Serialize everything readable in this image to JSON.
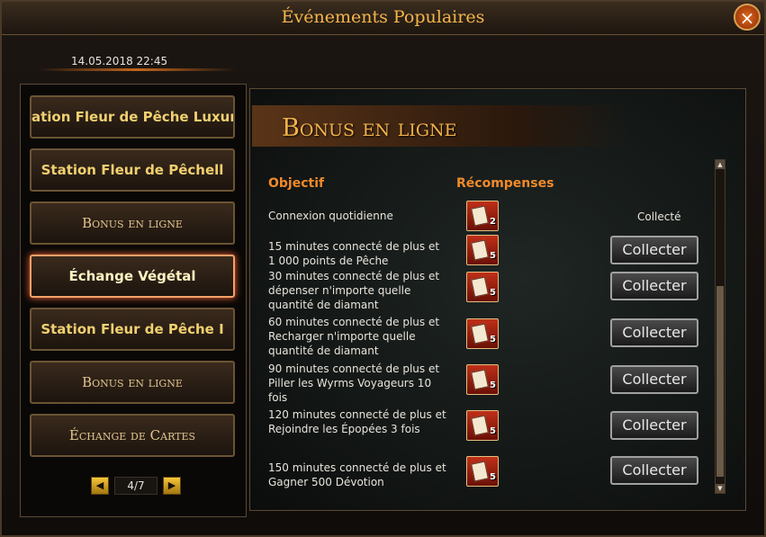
{
  "window": {
    "title": "Événements Populaires",
    "close_icon": "close-icon"
  },
  "datetime": "14.05.2018 22:45",
  "events": [
    {
      "label": "ation Fleur de Pêche Luxuriante",
      "style": "bold"
    },
    {
      "label": "Station Fleur de Pêchell",
      "style": "bold"
    },
    {
      "label": "Bonus en ligne",
      "style": "serif"
    },
    {
      "label": "Échange Végétal",
      "style": "bold",
      "active": true
    },
    {
      "label": "Station Fleur de Pêche I",
      "style": "bold"
    },
    {
      "label": "Bonus en ligne",
      "style": "serif"
    },
    {
      "label": "Échange de Cartes",
      "style": "serif"
    }
  ],
  "pager": {
    "page": "4/7",
    "prev_icon": "arrow-left-icon",
    "next_icon": "arrow-right-icon"
  },
  "panel": {
    "banner_title": "Bonus en ligne",
    "col_objective": "Objectif",
    "col_rewards": "Récompenses",
    "rows": [
      {
        "objective": "Connexion quotidienne",
        "reward_qty": "2",
        "status": "Collecté"
      },
      {
        "objective": "15 minutes connecté de plus et 1 000 points de Pêche",
        "reward_qty": "5",
        "button": "Collecter"
      },
      {
        "objective": "30 minutes connecté de plus et dépenser n'importe quelle quantité de diamant",
        "reward_qty": "5",
        "button": "Collecter"
      },
      {
        "objective": "60 minutes connecté de plus et Recharger n'importe quelle quantité de diamant",
        "reward_qty": "5",
        "button": "Collecter"
      },
      {
        "objective": "90 minutes connecté de plus et Piller les Wyrms Voyageurs 10 fois",
        "reward_qty": "5",
        "button": "Collecter"
      },
      {
        "objective": "120 minutes connecté de plus et Rejoindre les Épopées 3 fois",
        "reward_qty": "5",
        "button": "Collecter"
      },
      {
        "objective": "150 minutes connecté de plus et Gagner 500 Dévotion",
        "reward_qty": "5",
        "button": "Collecter"
      }
    ]
  },
  "colors": {
    "title": "#f4b64a",
    "header": "#f08a2a",
    "banner": "#f2b24a",
    "highlight": "#ff6a3a"
  }
}
